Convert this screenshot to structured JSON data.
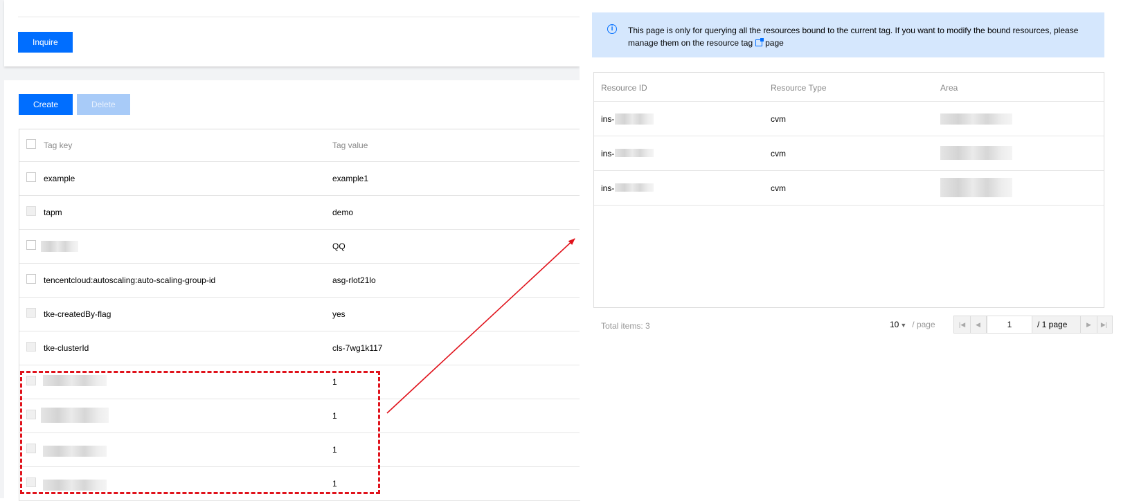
{
  "search_card": {
    "inquire_label": "Inquire"
  },
  "toolbar": {
    "create_label": "Create",
    "delete_label": "Delete"
  },
  "tag_table": {
    "columns": [
      "Tag key",
      "Tag value"
    ],
    "rows": [
      {
        "key": "example",
        "value": "example1"
      },
      {
        "key": "tapm",
        "value": "demo"
      },
      {
        "key": "",
        "value": "QQ"
      },
      {
        "key": "tencentcloud:autoscaling:auto-scaling-group-id",
        "value": "asg-rlot21lo"
      },
      {
        "key": "tke-createdBy-flag",
        "value": "yes"
      },
      {
        "key": "tke-clusterId",
        "value": "cls-7wg1k117"
      },
      {
        "key": "",
        "value": "1"
      },
      {
        "key": "",
        "value": "1"
      },
      {
        "key": "",
        "value": "1"
      },
      {
        "key": "",
        "value": "1"
      }
    ]
  },
  "notice": {
    "text_before": "This page is only for querying all the resources bound to the current tag. If you want to modify the bound resources, please manage them on the resource tag",
    "text_after": "page"
  },
  "resource_table": {
    "columns": [
      "Resource ID",
      "Resource Type",
      "Area"
    ],
    "rows": [
      {
        "id": "ins-",
        "type": "cvm"
      },
      {
        "id": "ins-",
        "type": "cvm"
      },
      {
        "id": "ins-",
        "type": "cvm"
      }
    ]
  },
  "pagination": {
    "total": "Total items: 3",
    "page_size": "10",
    "per_page": "/ page",
    "current_page": "1",
    "total_pages": "/ 1 page"
  },
  "colors": {
    "primary": "#006eff",
    "annotation": "#e0121b",
    "notice_bg": "#d5e7fd"
  }
}
